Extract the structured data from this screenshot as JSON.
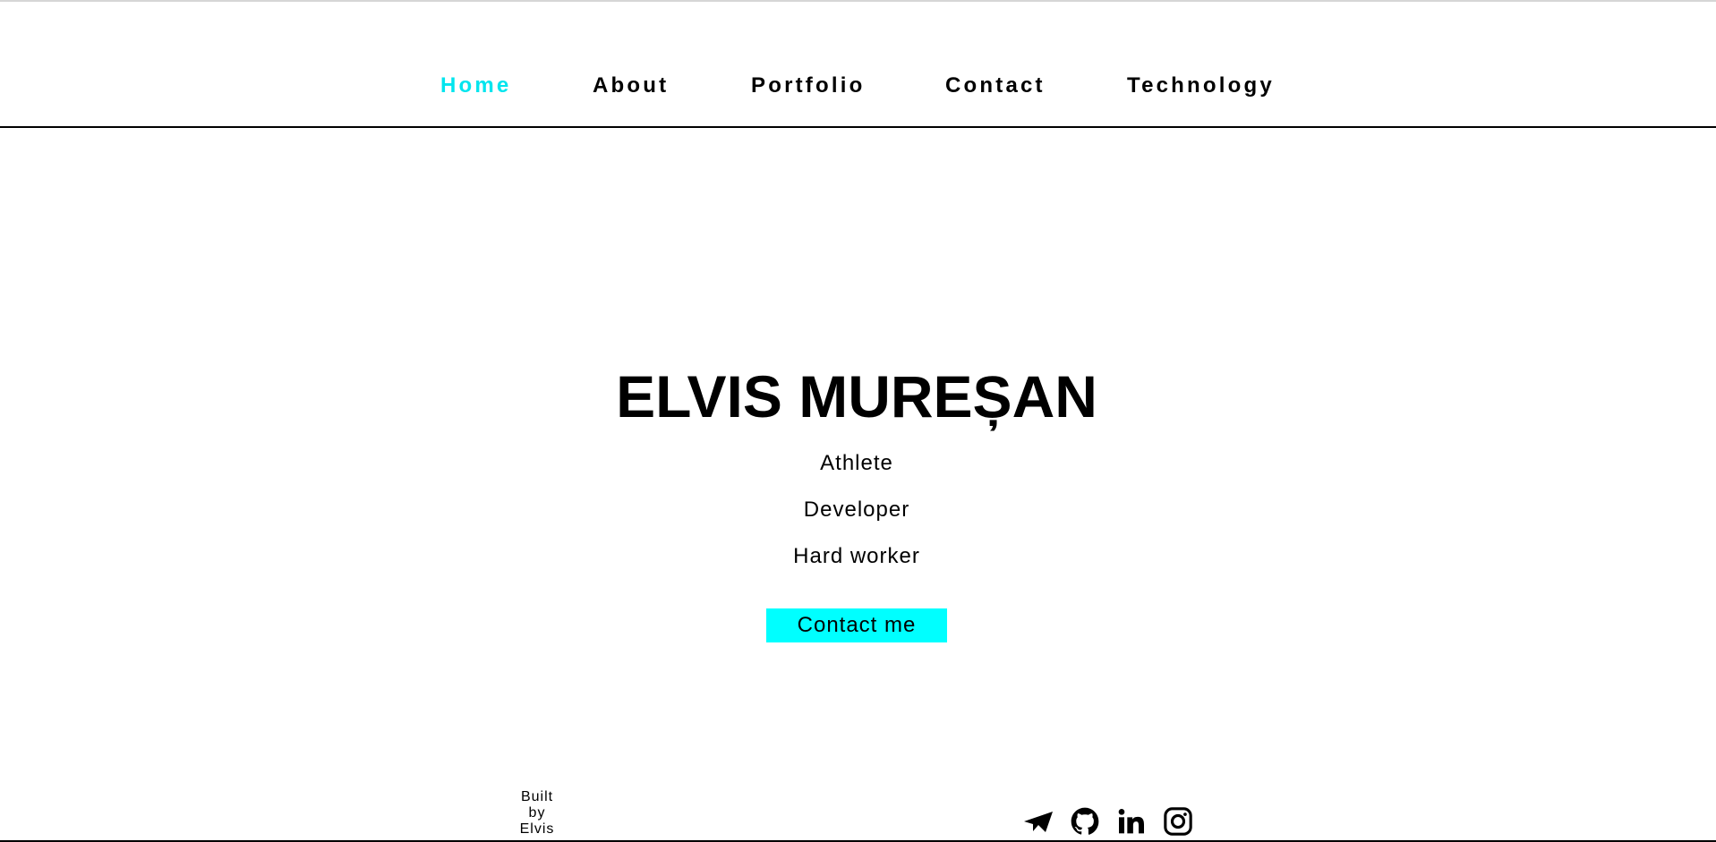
{
  "nav": {
    "items": [
      {
        "label": "Home",
        "active": true
      },
      {
        "label": "About",
        "active": false
      },
      {
        "label": "Portfolio",
        "active": false
      },
      {
        "label": "Contact",
        "active": false
      },
      {
        "label": "Technology",
        "active": false
      }
    ]
  },
  "hero": {
    "name": "ELVIS MUREȘAN",
    "roles": [
      "Athlete",
      "Developer",
      "Hard worker"
    ],
    "cta_label": "Contact me"
  },
  "footer": {
    "credit_lines": [
      "Built",
      "by",
      "Elvis"
    ],
    "social_icons": [
      "telegram-icon",
      "github-icon",
      "linkedin-icon",
      "instagram-icon"
    ]
  },
  "colors": {
    "accent": "#00ffff",
    "active_nav": "#00e5ee",
    "text": "#000000",
    "background": "#ffffff"
  }
}
